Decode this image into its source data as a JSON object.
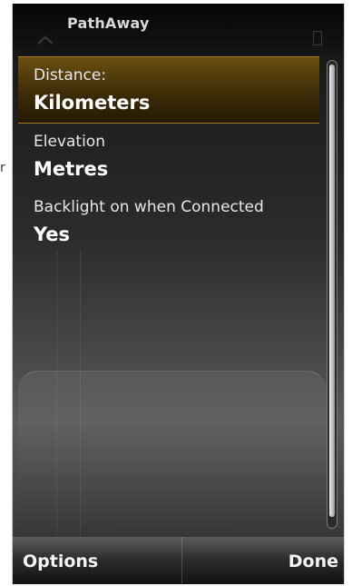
{
  "app": {
    "title": "PathAway"
  },
  "settings": [
    {
      "label": "Distance:",
      "value": "Kilometers",
      "selected": true
    },
    {
      "label": "Elevation",
      "value": "Metres",
      "selected": false
    },
    {
      "label": "Backlight on when Connected",
      "value": "Yes",
      "selected": false
    }
  ],
  "softkeys": {
    "left": "Options",
    "right": "Done"
  },
  "icons": {
    "status_left": "signal-icon",
    "status_right": "battery-icon"
  },
  "colors": {
    "selection": "#5a420c",
    "selection_border": "#a57d1f",
    "text": "#ffffff"
  }
}
